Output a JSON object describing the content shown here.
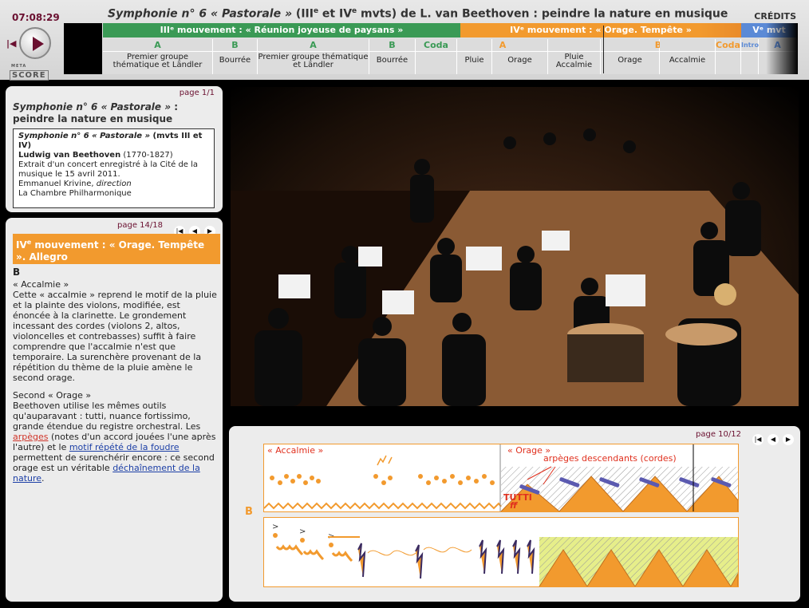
{
  "header": {
    "clock": "07:08:29",
    "title_italic": "Symphonie n° 6 « Pastorale »",
    "title_rest_1": " (III",
    "title_sup1": "e",
    "title_rest_2": " et IV",
    "title_sup2": "e",
    "title_rest_3": " mvts) de L. van Beethoven : peindre la nature en musique",
    "credits": "CRÉDITS",
    "logo_small": "META",
    "logo_big": "SCORE"
  },
  "timeline": {
    "movements": [
      {
        "label": "IIIᵉ mouvement : « Réunion joyeuse de paysans »",
        "color": "#3a9a55"
      },
      {
        "label": "IVᵉ mouvement : « Orage. Tempête »",
        "color": "#f29a2e"
      },
      {
        "label": "Vᵉ mvt",
        "color": "#5b8ad6"
      }
    ],
    "sections": [
      {
        "letter": "A",
        "label": "Premier groupe thématique et Ländler"
      },
      {
        "letter": "B",
        "label": "Bourrée"
      },
      {
        "letter": "A",
        "label": "Premier groupe thématique et Ländler"
      },
      {
        "letter": "B",
        "label": "Bourrée"
      },
      {
        "letter": "Coda",
        "label": ""
      },
      {
        "letter": "A",
        "label": "Pluie"
      },
      {
        "letter": "",
        "label": "Orage"
      },
      {
        "letter": "",
        "label": "Pluie Accalmie"
      },
      {
        "letter": "B",
        "label": "Orage"
      },
      {
        "letter": "",
        "label": "Accalmie"
      },
      {
        "letter": "Coda",
        "label": ""
      },
      {
        "letter": "Intro",
        "label": ""
      },
      {
        "letter": "A",
        "label": ""
      }
    ]
  },
  "info": {
    "page": "page 1/1",
    "heading_italic": "Symphonie n° 6 « Pastorale »",
    "heading_rest": " : peindre la nature en musique",
    "work_italic": "Symphonie n° 6 « Pastorale »",
    "work_rest": " (mvts III et IV)",
    "composer": "Ludwig van Beethoven",
    "dates": " (1770-1827)",
    "extract": "Extrait d'un concert enregistré à la Cité de la musique le 15 avril 2011.",
    "conductor": "Emmanuel Krivine, ",
    "conductor_role": "direction",
    "orchestra": "La Chambre Philharmonique"
  },
  "comment": {
    "page": "page 14/18",
    "header_1": "IV",
    "header_sup": "e",
    "header_2": " mouvement : « Orage. Tempête ». Allegro",
    "section": "B",
    "accalmie_title": "« Accalmie »",
    "accalmie_text": "Cette « accalmie » reprend le motif de la pluie et la plainte des violons, modifiée, est énoncée à la clarinette. Le grondement incessant des cordes (violons 2, altos, violoncelles et contrebasses) suffit à faire comprendre que l'accalmie n'est que temporaire. La surenchère provenant de la répétition du thème de la pluie amène le second orage.",
    "orage_title": "Second « Orage »",
    "orage_text_1": "Beethoven utilise les mêmes outils qu'auparavant : tutti, nuance fortissimo, grande étendue du registre orchestral. Les ",
    "link_arpeges": "arpèges",
    "orage_text_2": " (notes d'un accord jouées l'une après l'autre) et le ",
    "link_motif": "motif répété de la foudre",
    "orage_text_3": " permettent de surenchérir encore : ce second orage est un véritable ",
    "link_dechainement": "déchaînement de la nature",
    "orage_text_4": "."
  },
  "score": {
    "page": "page 10/12",
    "section": "B",
    "label_accalmie": "« Accalmie »",
    "label_orage": "« Orage »",
    "label_arpeges": "arpèges descendants (cordes)",
    "label_tutti": "TUTTI",
    "label_ff": "ff"
  },
  "icons": {
    "first": "skip-first-icon",
    "prev": "prev-icon",
    "next": "next-icon"
  }
}
